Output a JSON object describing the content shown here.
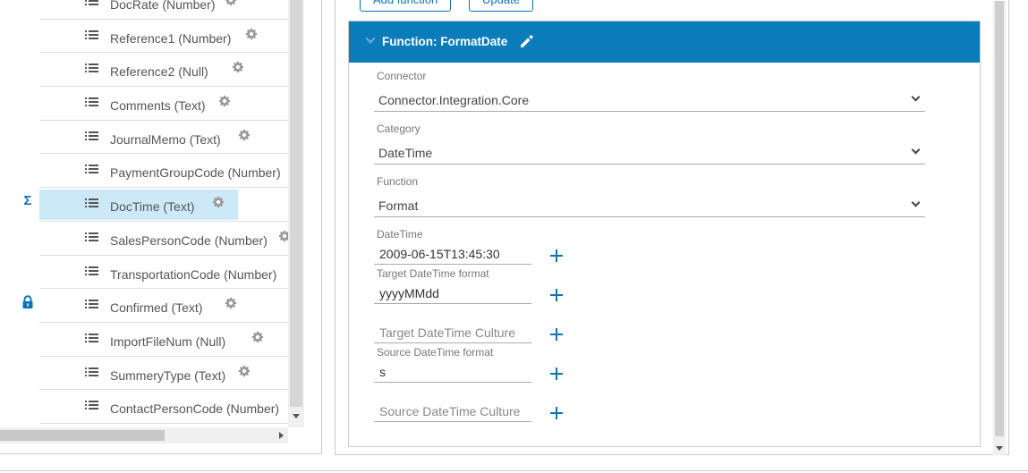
{
  "fields": [
    {
      "label": "DocRate (Number)",
      "gear": true
    },
    {
      "label": "Reference1 (Number)",
      "gear": true
    },
    {
      "label": "Reference2 (Null)",
      "gear": true
    },
    {
      "label": "Comments (Text)",
      "gear": true
    },
    {
      "label": "JournalMemo (Text)",
      "gear": true
    },
    {
      "label": "PaymentGroupCode (Number)",
      "gear": false
    },
    {
      "label": "DocTime (Text)",
      "gear": true,
      "selected": true
    },
    {
      "label": "SalesPersonCode (Number)",
      "gear": true
    },
    {
      "label": "TransportationCode (Number)",
      "gear": false
    },
    {
      "label": "Confirmed (Text)",
      "gear": true
    },
    {
      "label": "ImportFileNum (Null)",
      "gear": true
    },
    {
      "label": "SummeryType (Text)",
      "gear": true
    },
    {
      "label": "ContactPersonCode (Number)",
      "gear": false
    }
  ],
  "gutter": {
    "sigma": "Σ",
    "lock": "lock-icon"
  },
  "toolbar": {
    "add_function": "Add function",
    "update": "Update"
  },
  "function_header": {
    "title": "Function: FormatDate"
  },
  "connector": {
    "caption": "Connector",
    "value": "Connector.Integration.Core"
  },
  "category": {
    "caption": "Category",
    "value": "DateTime"
  },
  "function": {
    "caption": "Function",
    "value": "Format"
  },
  "params": {
    "datetime": {
      "caption": "DateTime",
      "value": "2009-06-15T13:45:30"
    },
    "target_format": {
      "caption": "Target DateTime format",
      "value": "yyyyMMdd"
    },
    "target_culture": {
      "placeholder": "Target DateTime Culture"
    },
    "source_format": {
      "caption": "Source DateTime format",
      "value": "s"
    },
    "source_culture": {
      "placeholder": "Source DateTime Culture"
    }
  },
  "colors": {
    "accent": "#0b7cba",
    "selected_row": "#cde8f7"
  }
}
